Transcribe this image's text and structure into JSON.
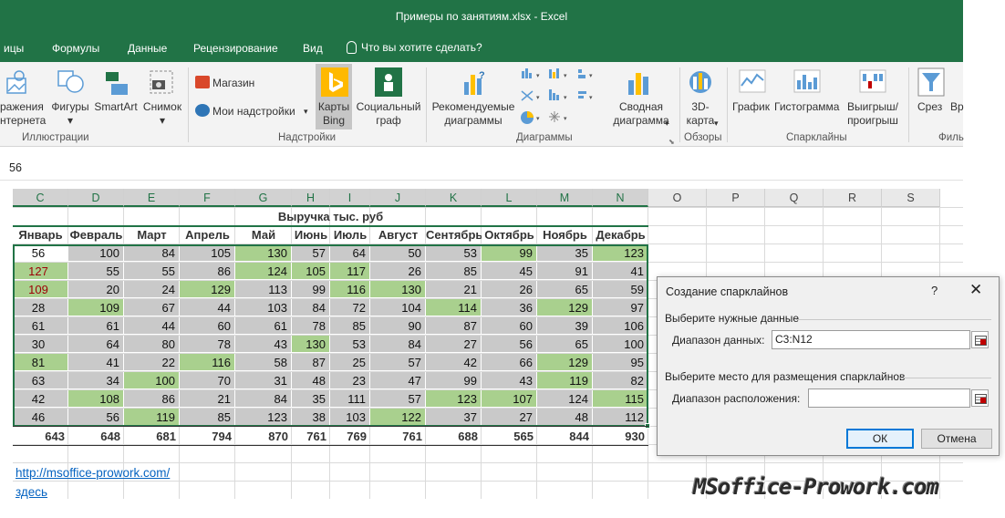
{
  "window": {
    "title": "Примеры по занятиям.xlsx - Excel"
  },
  "menu": {
    "tabs": [
      "ицы",
      "Формулы",
      "Данные",
      "Рецензирование",
      "Вид"
    ],
    "tell_me": "Что вы хотите сделать?"
  },
  "ribbon": {
    "illustrations": {
      "items": [
        {
          "line1": "ражения",
          "line2": "нтернета"
        },
        {
          "line1": "Фигуры",
          "line2": "▾"
        },
        {
          "line1": "SmartArt",
          "line2": ""
        },
        {
          "line1": "Снимок",
          "line2": "▾"
        }
      ],
      "group_label": "Иллюстрации"
    },
    "addins": {
      "store": "Магазин",
      "my_addins": "Мои надстройки",
      "bing_l1": "Карты",
      "bing_l2": "Bing",
      "social_l1": "Социальный",
      "social_l2": "граф",
      "group_label": "Надстройки"
    },
    "charts": {
      "recommended_l1": "Рекомендуемые",
      "recommended_l2": "диаграммы",
      "pivot_l1": "Сводная",
      "pivot_l2": "диаграмма",
      "group_label": "Диаграммы"
    },
    "tours": {
      "l1": "3D-",
      "l2": "карта",
      "group_label": "Обзоры"
    },
    "sparklines": {
      "line": "График",
      "column": "Гистограмма",
      "winloss_l1": "Выигрыш/",
      "winloss_l2": "проигрыш",
      "group_label": "Спарклайны"
    },
    "filters": {
      "slicer": "Срез",
      "timeline": "Вр",
      "group_label": "Филь"
    }
  },
  "formula_bar": {
    "value": "56"
  },
  "columns": [
    "C",
    "D",
    "E",
    "F",
    "G",
    "H",
    "I",
    "J",
    "K",
    "L",
    "M",
    "N",
    "O",
    "P",
    "Q",
    "R",
    "S"
  ],
  "table": {
    "title": "Выручка тыс. руб",
    "months": [
      "Январь",
      "Февраль",
      "Март",
      "Апрель",
      "Май",
      "Июнь",
      "Июль",
      "Август",
      "Сентябрь",
      "Октябрь",
      "Ноябрь",
      "Декабрь"
    ],
    "rows": [
      [
        56,
        100,
        84,
        105,
        130,
        57,
        64,
        50,
        53,
        99,
        35,
        123
      ],
      [
        127,
        55,
        55,
        86,
        124,
        105,
        117,
        26,
        85,
        45,
        91,
        41
      ],
      [
        109,
        20,
        24,
        129,
        113,
        99,
        116,
        130,
        21,
        26,
        65,
        59
      ],
      [
        28,
        109,
        67,
        44,
        103,
        84,
        72,
        104,
        114,
        36,
        129,
        97
      ],
      [
        61,
        61,
        44,
        60,
        61,
        78,
        85,
        90,
        87,
        60,
        39,
        106
      ],
      [
        30,
        64,
        80,
        78,
        43,
        130,
        53,
        84,
        27,
        56,
        65,
        100
      ],
      [
        81,
        41,
        22,
        116,
        58,
        87,
        25,
        57,
        42,
        66,
        129,
        95
      ],
      [
        63,
        34,
        100,
        70,
        31,
        48,
        23,
        47,
        99,
        43,
        119,
        82
      ],
      [
        42,
        108,
        86,
        21,
        84,
        35,
        111,
        57,
        123,
        107,
        124,
        115
      ],
      [
        46,
        56,
        119,
        85,
        123,
        38,
        103,
        122,
        37,
        27,
        48,
        112
      ]
    ],
    "totals": [
      643,
      648,
      681,
      794,
      870,
      761,
      769,
      761,
      688,
      565,
      844,
      930
    ],
    "colors": {
      "gray": "#c9c9c9",
      "green": "#a9d08e",
      "red_text": "#9c0006"
    }
  },
  "link": {
    "text": "http://msoffice-prowork.com/"
  },
  "link2": {
    "text": "здесь"
  },
  "dialog": {
    "title": "Создание спарклайнов",
    "help": "?",
    "close": "✕",
    "section1": "Выберите нужные данные",
    "data_range_label": "Диапазон данных:",
    "data_range_value": "C3:N12",
    "section2": "Выберите место для размещения спарклайнов",
    "location_label": "Диапазон расположения:",
    "location_value": "",
    "ok": "ОК",
    "cancel": "Отмена"
  },
  "watermark": {
    "text": "MSoffice-Prowork.com"
  }
}
